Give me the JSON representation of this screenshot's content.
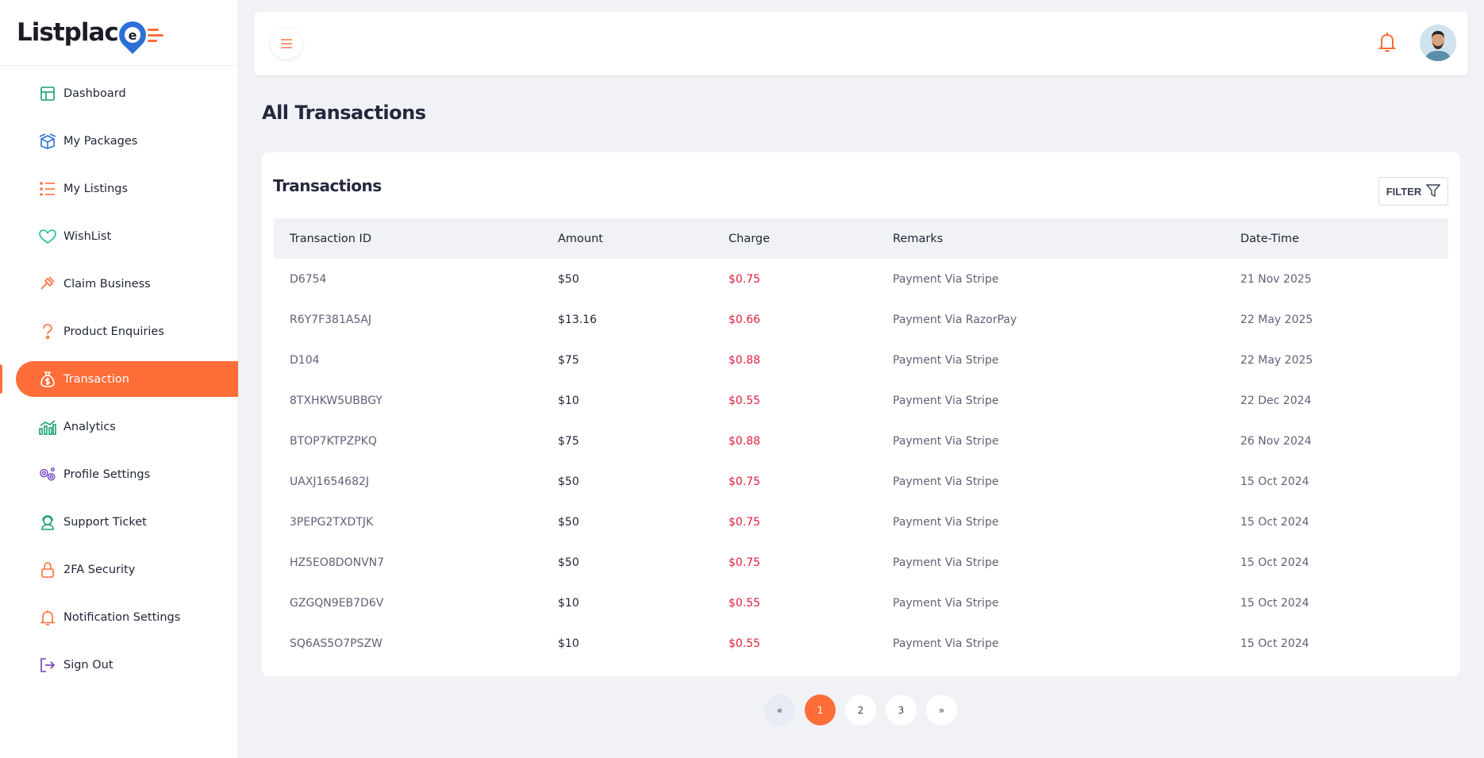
{
  "app": {
    "logo_text": "Listplac",
    "logo_badge": "e"
  },
  "sidebar": {
    "items": [
      {
        "label": "Dashboard",
        "icon": "grid-icon"
      },
      {
        "label": "My Packages",
        "icon": "box-icon"
      },
      {
        "label": "My Listings",
        "icon": "list-icon"
      },
      {
        "label": "WishList",
        "icon": "heart-icon"
      },
      {
        "label": "Claim Business",
        "icon": "hammer-icon"
      },
      {
        "label": "Product Enquiries",
        "icon": "question-icon"
      },
      {
        "label": "Transaction",
        "icon": "money-bag-icon",
        "active": true
      },
      {
        "label": "Analytics",
        "icon": "analytics-icon"
      },
      {
        "label": "Profile Settings",
        "icon": "gears-icon"
      },
      {
        "label": "Support Ticket",
        "icon": "support-icon"
      },
      {
        "label": "2FA Security",
        "icon": "lock-icon"
      },
      {
        "label": "Notification Settings",
        "icon": "bell-icon"
      },
      {
        "label": "Sign Out",
        "icon": "sign-out-icon"
      }
    ]
  },
  "page": {
    "title": "All Transactions"
  },
  "card": {
    "title": "Transactions",
    "filter_label": "FILTER"
  },
  "table": {
    "columns": [
      "Transaction ID",
      "Amount",
      "Charge",
      "Remarks",
      "Date-Time"
    ],
    "rows": [
      [
        "D6754",
        "$50",
        "$0.75",
        "Payment Via Stripe",
        "21 Nov 2025"
      ],
      [
        "R6Y7F381A5AJ",
        "$13.16",
        "$0.66",
        "Payment Via RazorPay",
        "22 May 2025"
      ],
      [
        "D104",
        "$75",
        "$0.88",
        "Payment Via Stripe",
        "22 May 2025"
      ],
      [
        "8TXHKW5UBBGY",
        "$10",
        "$0.55",
        "Payment Via Stripe",
        "22 Dec 2024"
      ],
      [
        "BTOP7KTPZPKQ",
        "$75",
        "$0.88",
        "Payment Via Stripe",
        "26 Nov 2024"
      ],
      [
        "UAXJ1654682J",
        "$50",
        "$0.75",
        "Payment Via Stripe",
        "15 Oct 2024"
      ],
      [
        "3PEPG2TXDTJK",
        "$50",
        "$0.75",
        "Payment Via Stripe",
        "15 Oct 2024"
      ],
      [
        "HZ5EO8DONVN7",
        "$50",
        "$0.75",
        "Payment Via Stripe",
        "15 Oct 2024"
      ],
      [
        "GZGQN9EB7D6V",
        "$10",
        "$0.55",
        "Payment Via Stripe",
        "15 Oct 2024"
      ],
      [
        "SQ6AS5O7PSZW",
        "$10",
        "$0.55",
        "Payment Via Stripe",
        "15 Oct 2024"
      ]
    ]
  },
  "pagination": {
    "prev": "«",
    "pages": [
      "1",
      "2",
      "3"
    ],
    "current": "1",
    "next": "»"
  },
  "colors": {
    "accent": "#ff6d38",
    "charge": "#e11d3c"
  }
}
